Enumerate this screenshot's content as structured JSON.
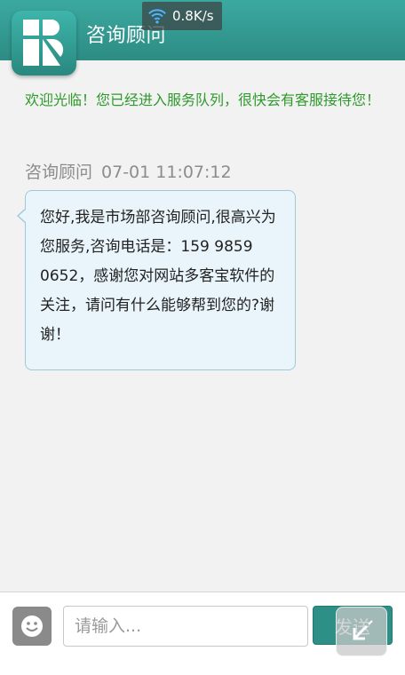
{
  "header": {
    "title": "咨询顾问",
    "network_speed": "0.8K/s"
  },
  "chat": {
    "welcome_message": "欢迎光临！您已经进入服务队列，很快会有客服接待您！",
    "messages": [
      {
        "sender": "咨询顾问",
        "time": "07-01 11:07:12",
        "text": "您好,我是市场部咨询顾问,很高兴为您服务,咨询电话是：159 9859 0652，感谢您对网站多客宝软件的关注，请问有什么能够帮到您的?谢谢！"
      }
    ]
  },
  "composer": {
    "input_placeholder": "请输入...",
    "send_label": "发送"
  },
  "icons": {
    "logo": "brand-logo-icon",
    "wifi": "wifi-icon",
    "emoji": "smiley-icon",
    "overlay": "shrink-arrow-icon"
  },
  "colors": {
    "header": "#2f9189",
    "welcome_text": "#2e9a2b",
    "bubble_bg": "#e9f5fb",
    "send_button": "#2e8f86"
  }
}
